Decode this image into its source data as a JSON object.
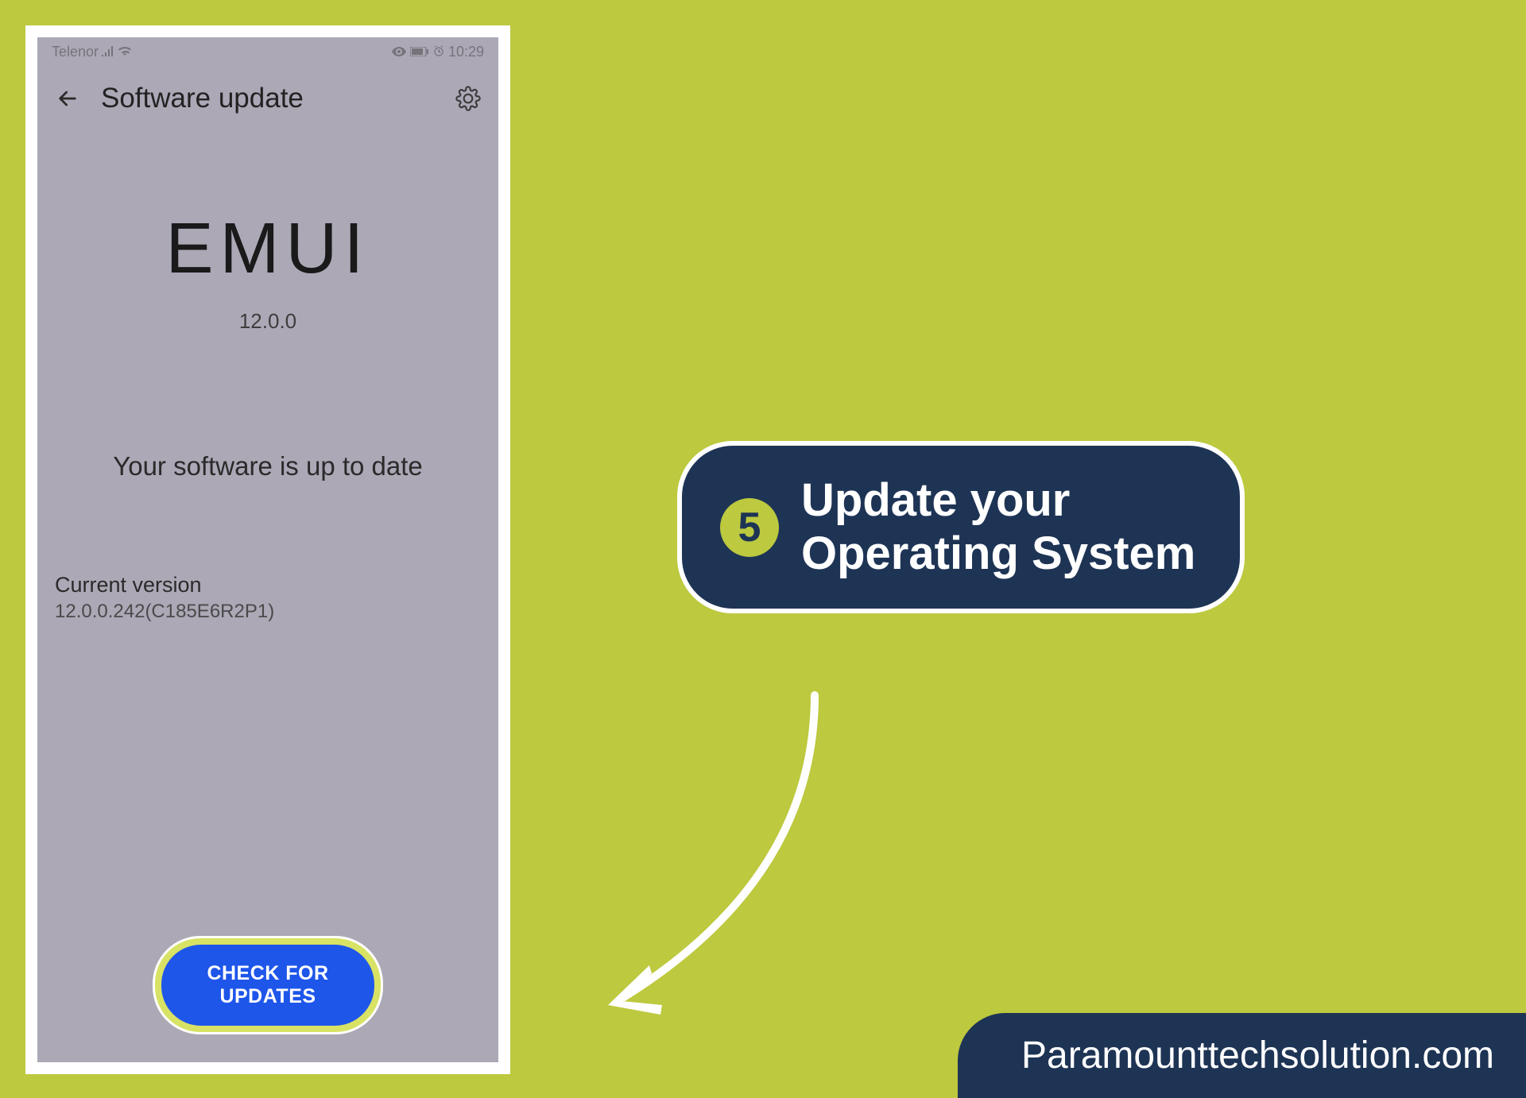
{
  "phone": {
    "status_bar": {
      "carrier": "Telenor",
      "time": "10:29"
    },
    "nav": {
      "title": "Software update"
    },
    "emui": {
      "logo": "EMUI",
      "version": "12.0.0"
    },
    "status_message": "Your software is up to date",
    "current_version": {
      "label": "Current version",
      "value": "12.0.0.242(C185E6R2P1)"
    },
    "check_button": "CHECK FOR UPDATES"
  },
  "callout": {
    "step_number": "5",
    "line1": "Update your",
    "line2": "Operating System"
  },
  "brand": "Paramounttechsolution.com"
}
